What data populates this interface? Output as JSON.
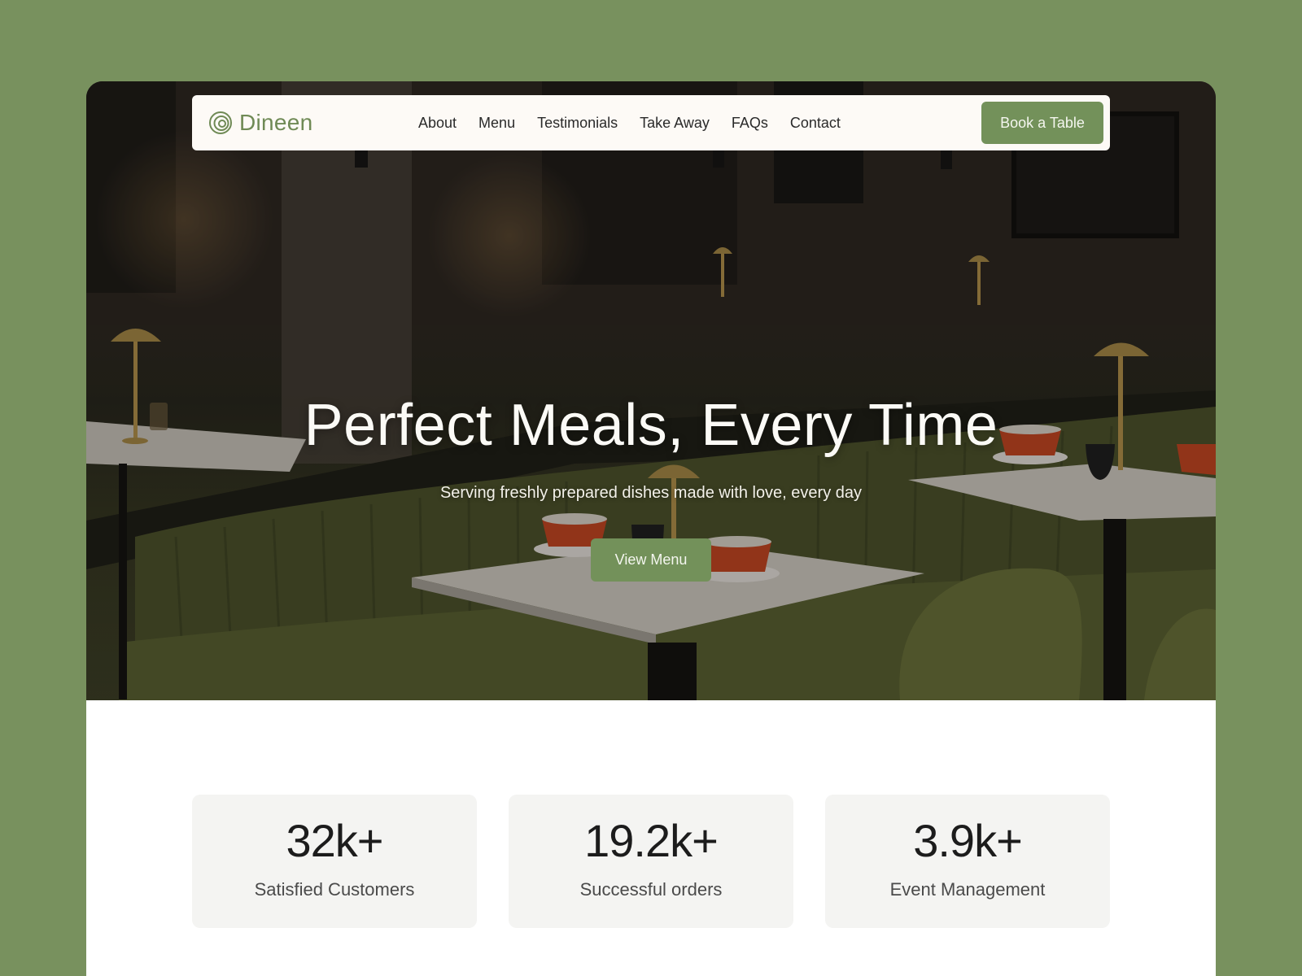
{
  "brand": {
    "name": "Dineen",
    "logo_icon": "spiral-logo-icon",
    "accent": "#73915a"
  },
  "nav": {
    "links": [
      "About",
      "Menu",
      "Testimonials",
      "Take Away",
      "FAQs",
      "Contact"
    ],
    "cta": "Book a Table"
  },
  "hero": {
    "title": "Perfect Meals, Every Time",
    "subtitle": "Serving freshly prepared dishes made with love, every day",
    "cta": "View Menu",
    "image": "restaurant-interior-image"
  },
  "stats": [
    {
      "value": "32k+",
      "label": "Satisfied Customers"
    },
    {
      "value": "19.2k+",
      "label": "Successful orders"
    },
    {
      "value": "3.9k+",
      "label": "Event Management"
    }
  ],
  "colors": {
    "page_bg": "#78915e",
    "card_bg": "#f4f4f2",
    "nav_bg": "#fdfaf6"
  }
}
